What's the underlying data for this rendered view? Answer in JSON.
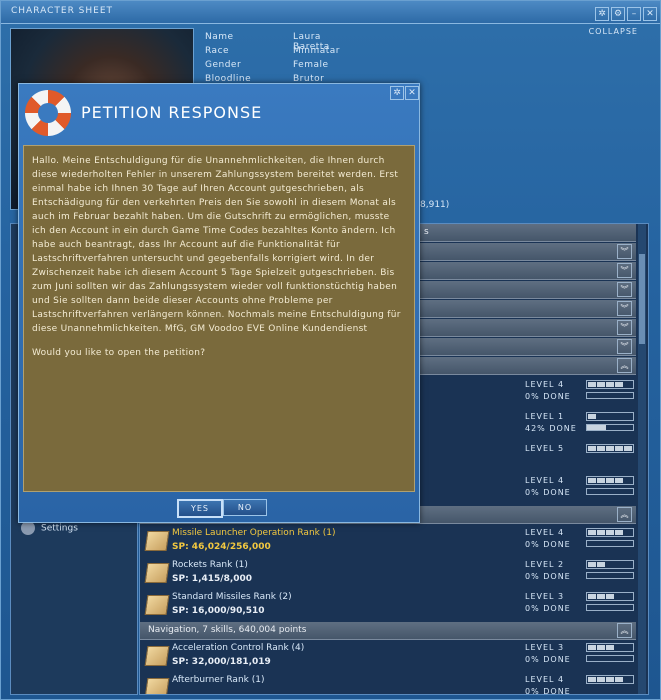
{
  "character_sheet": {
    "title": "CHARACTER SHEET",
    "collapse_label": "COLLAPSE",
    "title_buttons": [
      "✲",
      "⚙",
      "–",
      "✕"
    ],
    "info": [
      {
        "label": "Name",
        "value": "Laura Baretta"
      },
      {
        "label": "Race",
        "value": "Minmatar"
      },
      {
        "label": "Gender",
        "value": "Female"
      },
      {
        "label": "Bloodline",
        "value": "Brutor"
      }
    ],
    "isk_fragment": "8,911)",
    "skill_header_fragment": "s",
    "settings_label": "Settings"
  },
  "skills": {
    "missile_group": "",
    "navigation_group": "Navigation, 7 skills, 640,004 points",
    "rows_upper": [
      {
        "level": "LEVEL 4",
        "done": "0% DONE",
        "filled": 4,
        "pct": 0
      },
      {
        "level": "LEVEL 1",
        "done": "42% DONE",
        "filled": 1,
        "pct": 42
      },
      {
        "level": "LEVEL 5",
        "done": "",
        "filled": 5,
        "pct": 0
      },
      {
        "level": "LEVEL 4",
        "done": "0% DONE",
        "filled": 4,
        "pct": 0
      }
    ],
    "missile_rows": [
      {
        "name": "Missile Launcher Operation Rank (1)",
        "sp": "SP: 46,024/256,000",
        "level": "LEVEL 4",
        "done": "0% DONE",
        "filled": 4,
        "pct": 0,
        "highlight": true
      },
      {
        "name": "Rockets Rank (1)",
        "sp": "SP: 1,415/8,000",
        "level": "LEVEL 2",
        "done": "0% DONE",
        "filled": 2,
        "pct": 0,
        "highlight": false
      },
      {
        "name": "Standard Missiles Rank (2)",
        "sp": "SP: 16,000/90,510",
        "level": "LEVEL 3",
        "done": "0% DONE",
        "filled": 3,
        "pct": 0,
        "highlight": false
      }
    ],
    "navigation_rows": [
      {
        "name": "Acceleration Control Rank (4)",
        "sp": "SP: 32,000/181,019",
        "level": "LEVEL 3",
        "done": "0% DONE",
        "filled": 3,
        "pct": 0,
        "highlight": false
      },
      {
        "name": "Afterburner Rank (1)",
        "sp": "",
        "level": "LEVEL 4",
        "done": "0% DONE",
        "filled": 4,
        "pct": 0,
        "highlight": false
      }
    ]
  },
  "petition": {
    "title": "PETITION RESPONSE",
    "message": "Hallo. Meine Entschuldigung für die Unannehmlichkeiten, die Ihnen durch diese wiederholten Fehler in unserem Zahlungssystem bereitet werden. Erst einmal habe ich Ihnen 30 Tage auf Ihren Account gutgeschrieben, als Entschädigung für den verkehrten Preis den Sie sowohl in diesem Monat als auch im Februar bezahlt haben. Um die Gutschrift zu ermöglichen, musste ich den Account in ein durch Game Time Codes bezahltes Konto ändern. Ich habe auch beantragt, dass Ihr Account auf die Funktionalität für Lastschriftverfahren untersucht und gegebenfalls korrigiert wird. In der Zwischenzeit habe ich diesem Account 5 Tage Spielzeit gutgeschrieben. Bis zum Juni sollten wir das Zahlungssystem wieder voll funktionstüchtig haben und Sie sollten dann beide dieser Accounts ohne Probleme per Lastschriftverfahren verlängern können. Nochmals meine Entschuldigung für diese Unannehmlichkeiten. MfG, GM Voodoo EVE Online Kundendienst",
    "question": "Would you like to open the petition?",
    "yes_label": "YES",
    "no_label": "NO",
    "title_buttons": [
      "✲",
      "✕"
    ]
  }
}
